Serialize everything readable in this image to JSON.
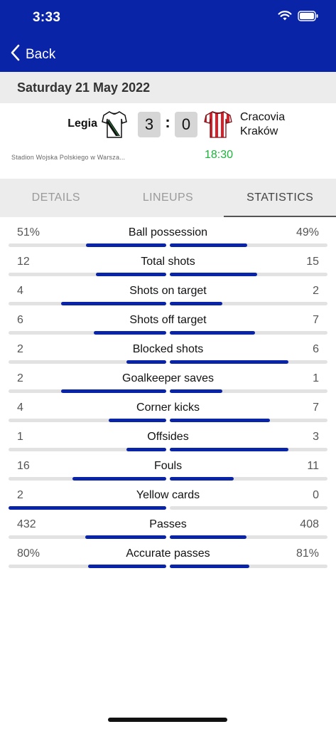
{
  "status": {
    "time": "3:33"
  },
  "nav": {
    "back_label": "Back"
  },
  "match": {
    "date": "Saturday 21 May 2022",
    "home_team": "Legia",
    "away_team_line1": "Cracovia",
    "away_team_line2": "Kraków",
    "home_score": "3",
    "away_score": "0",
    "separator": ":",
    "venue": "Stadion Wojska Polskiego w Warsza...",
    "kickoff": "18:30"
  },
  "tabs": [
    {
      "label": "DETAILS",
      "active": false
    },
    {
      "label": "LINEUPS",
      "active": false
    },
    {
      "label": "STATISTICS",
      "active": true
    }
  ],
  "stats": [
    {
      "label": "Ball possession",
      "home": "51%",
      "away": "49%",
      "home_val": 51,
      "away_val": 49
    },
    {
      "label": "Total shots",
      "home": "12",
      "away": "15",
      "home_val": 12,
      "away_val": 15
    },
    {
      "label": "Shots on target",
      "home": "4",
      "away": "2",
      "home_val": 4,
      "away_val": 2
    },
    {
      "label": "Shots off target",
      "home": "6",
      "away": "7",
      "home_val": 6,
      "away_val": 7
    },
    {
      "label": "Blocked shots",
      "home": "2",
      "away": "6",
      "home_val": 2,
      "away_val": 6
    },
    {
      "label": "Goalkeeper saves",
      "home": "2",
      "away": "1",
      "home_val": 2,
      "away_val": 1
    },
    {
      "label": "Corner kicks",
      "home": "4",
      "away": "7",
      "home_val": 4,
      "away_val": 7
    },
    {
      "label": "Offsides",
      "home": "1",
      "away": "3",
      "home_val": 1,
      "away_val": 3
    },
    {
      "label": "Fouls",
      "home": "16",
      "away": "11",
      "home_val": 16,
      "away_val": 11
    },
    {
      "label": "Yellow cards",
      "home": "2",
      "away": "0",
      "home_val": 2,
      "away_val": 0
    },
    {
      "label": "Passes",
      "home": "432",
      "away": "408",
      "home_val": 432,
      "away_val": 408
    },
    {
      "label": "Accurate passes",
      "home": "80%",
      "away": "81%",
      "home_val": 80,
      "away_val": 81
    }
  ],
  "colors": {
    "header": "#0a24a8",
    "bar_fill": "#0a24a8",
    "bar_track": "#e2e2e2",
    "kickoff": "#1db43c"
  },
  "icons": {
    "back": "chevron-left-icon",
    "wifi": "wifi-icon",
    "battery": "battery-icon",
    "home_shirt": "legia-shirt-icon",
    "away_shirt": "cracovia-shirt-icon"
  }
}
